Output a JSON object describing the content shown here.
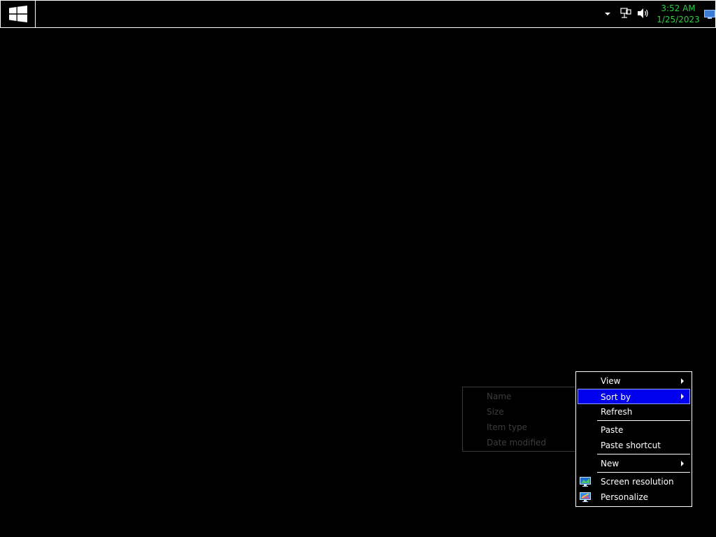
{
  "taskbar": {
    "start_icon": "windows-logo-icon",
    "tray": {
      "chevron_icon": "chevron-down-icon",
      "network_icon": "network-icon",
      "volume_icon": "volume-icon",
      "time": "3:52 AM",
      "date": "1/25/2023",
      "show_desktop_icon": "monitor-icon"
    },
    "colors": {
      "clock_text": "#2ecc40",
      "border": "#ffffff",
      "background": "#000000"
    }
  },
  "context_menu": {
    "items": [
      {
        "label": "View",
        "has_submenu": true
      },
      {
        "label": "Sort by",
        "has_submenu": true,
        "highlighted": true
      },
      {
        "label": "Refresh"
      },
      {
        "label": "Paste"
      },
      {
        "label": "Paste shortcut"
      },
      {
        "label": "New",
        "has_submenu": true
      },
      {
        "label": "Screen resolution",
        "icon": "screen-resolution-icon"
      },
      {
        "label": "Personalize",
        "icon": "personalize-icon"
      }
    ],
    "highlight_color": "#0000ee"
  },
  "sort_submenu": {
    "items": [
      {
        "label": "Name"
      },
      {
        "label": "Size"
      },
      {
        "label": "Item type"
      },
      {
        "label": "Date modified"
      }
    ]
  }
}
